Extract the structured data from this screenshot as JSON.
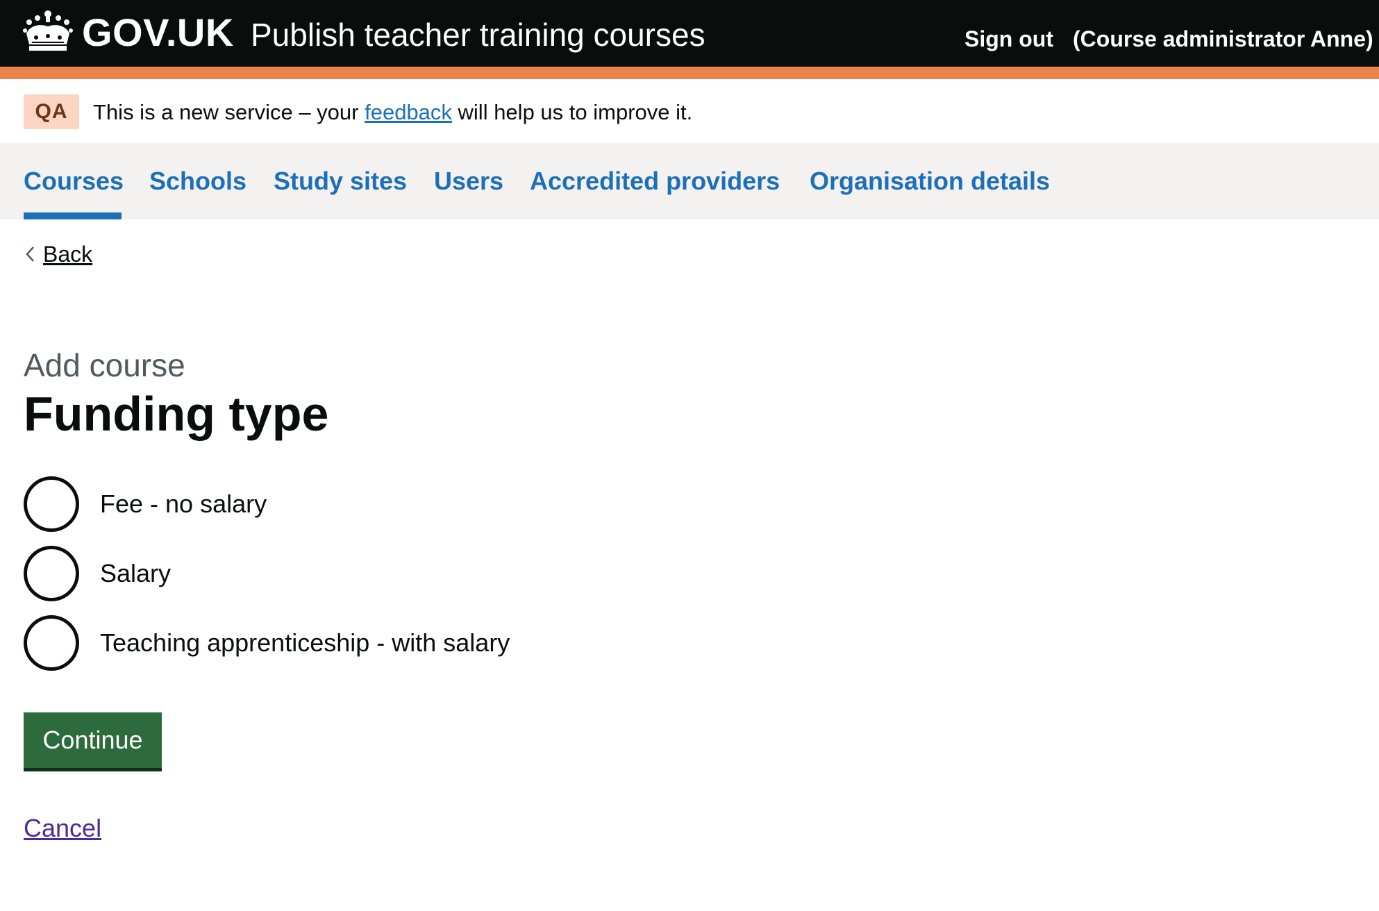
{
  "header": {
    "logotype": "GOV.UK",
    "service_name": "Publish teacher training courses",
    "sign_out": "Sign out",
    "user": "(Course administrator Anne)"
  },
  "phase_banner": {
    "tag": "QA",
    "text_before": "This is a new service – your ",
    "link": "feedback",
    "text_after": " will help us to improve it."
  },
  "nav": {
    "items": [
      {
        "label": "Courses",
        "active": true
      },
      {
        "label": "Schools"
      },
      {
        "label": "Study sites"
      },
      {
        "label": "Users"
      },
      {
        "label": "Accredited providers"
      },
      {
        "label": "Organisation details"
      }
    ]
  },
  "back": "Back",
  "page": {
    "caption": "Add course",
    "title": "Funding type"
  },
  "radios": [
    {
      "label": "Fee - no salary",
      "checked": false
    },
    {
      "label": "Salary",
      "checked": false
    },
    {
      "label": "Teaching apprenticeship - with salary",
      "checked": false
    }
  ],
  "actions": {
    "continue": "Continue",
    "cancel": "Cancel"
  },
  "colors": {
    "header_bg": "#0b0c0c",
    "header_bar": "#e8844c",
    "link": "#1d70b8",
    "button": "#2d6b3c",
    "visited_link": "#4c2c92"
  },
  "icons": [
    "crown-logo-icon",
    "chevron-left-icon"
  ]
}
